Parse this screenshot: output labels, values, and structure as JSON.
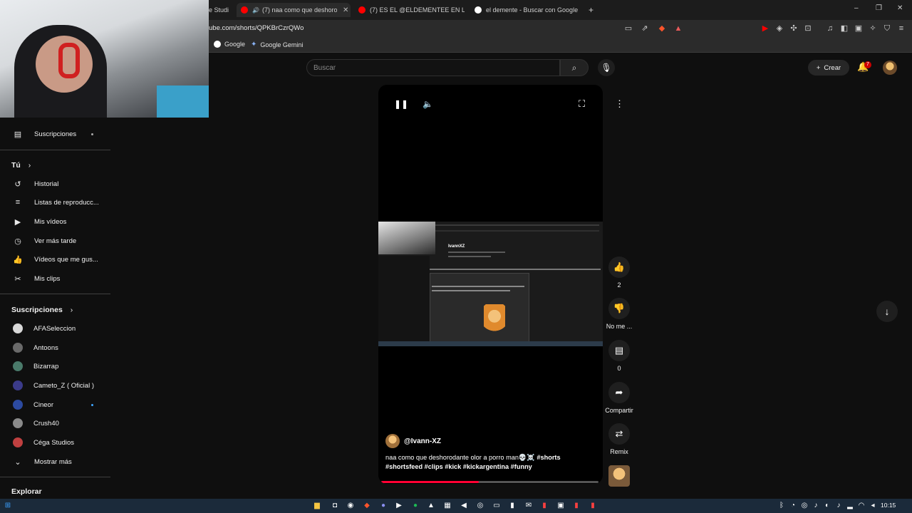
{
  "browser": {
    "tabs": [
      {
        "title": "e Studi",
        "active": false,
        "fav_color": "#444444"
      },
      {
        "title": "(7) naa como que deshorodar",
        "active": true,
        "fav_color": "#ff0000"
      },
      {
        "title": "(7) ES EL @ELDEMENTEE EN LA PELU",
        "active": false,
        "fav_color": "#ff0000"
      },
      {
        "title": "el demente - Buscar con Google",
        "active": false,
        "fav_color": "#ffffff"
      }
    ],
    "new_tab": "+",
    "url": "ube.com/shorts/QPKBrCzrQWo",
    "bookmarks": [
      {
        "label": "Google"
      },
      {
        "label": "Google Gemini"
      }
    ],
    "window_controls": {
      "minimize": "–",
      "restore": "❐",
      "close": "✕"
    }
  },
  "header": {
    "search_placeholder": "Buscar",
    "create_label": "Crear",
    "notifications_count": "7"
  },
  "sidebar": {
    "subscriptions_link": "Suscripciones",
    "you_heading": "Tú",
    "you_items": [
      {
        "label": "Historial",
        "icon": "history-icon",
        "glyph": "↺"
      },
      {
        "label": "Listas de reproducc...",
        "icon": "playlist-icon",
        "glyph": "≡"
      },
      {
        "label": "Mis vídeos",
        "icon": "my-videos-icon",
        "glyph": "▶"
      },
      {
        "label": "Ver más tarde",
        "icon": "watch-later-icon",
        "glyph": "◷"
      },
      {
        "label": "Vídeos que me gus...",
        "icon": "liked-icon",
        "glyph": "👍"
      },
      {
        "label": "Mis clips",
        "icon": "clips-icon",
        "glyph": "✂"
      }
    ],
    "subs_heading": "Suscripciones",
    "channels": [
      {
        "label": "AFASeleccion",
        "color": "#d8d8d8",
        "new": false
      },
      {
        "label": "Antoons",
        "color": "#6a6a6a",
        "new": false
      },
      {
        "label": "Bizarrap",
        "color": "#4a7a6a",
        "new": false
      },
      {
        "label": "Cameto_Z ( Oficial )",
        "color": "#3b3b8a",
        "new": false
      },
      {
        "label": "Cineor",
        "color": "#2c4aa0",
        "new": true
      },
      {
        "label": "Crush40",
        "color": "#8a8a8a",
        "new": false
      },
      {
        "label": "Céga Studios",
        "color": "#c04040",
        "new": false
      }
    ],
    "show_more": "Mostrar más",
    "explore_heading": "Explorar"
  },
  "short": {
    "channel_handle": "@Ivann-XZ",
    "caption": "naa como que deshorodante olor a porro man💀☠️ ",
    "caption_tags_1": "#shorts",
    "caption_tags_2": "#shortsfeed #clips #kick #kickargentina #funny",
    "inner_channel_name": "IvannXZ",
    "progress_fraction": 0.45
  },
  "actions": {
    "like_count": "2",
    "dislike_label": "No me ...",
    "comments_count": "0",
    "share_label": "Compartir",
    "remix_label": "Remix"
  },
  "taskbar": {
    "time": "10:15"
  }
}
